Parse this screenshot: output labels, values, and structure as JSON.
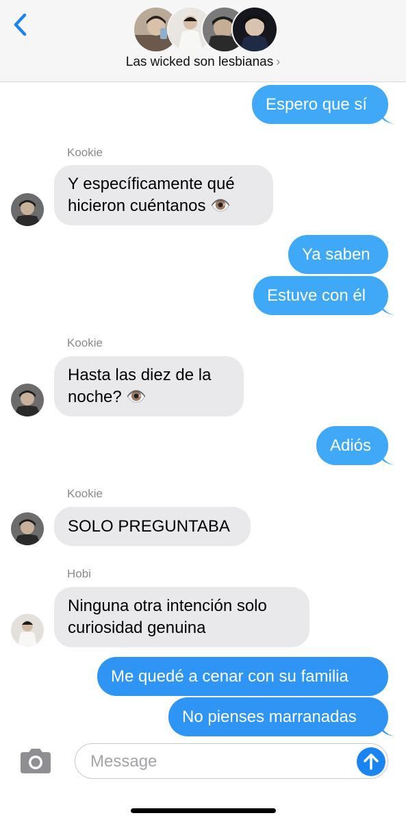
{
  "header": {
    "title": "Las wicked son lesbianas",
    "chevron": "›",
    "back_icon": "chevron-left-icon"
  },
  "messages": [
    {
      "direction": "out",
      "text": "Espero que sí"
    },
    {
      "direction": "in",
      "sender": "Kookie",
      "line1": "Y específicamente qué",
      "line2": "hicieron cuéntanos 👁️"
    },
    {
      "direction": "out",
      "text": "Ya saben"
    },
    {
      "direction": "out",
      "text": "Estuve con él"
    },
    {
      "direction": "in",
      "sender": "Kookie",
      "line1": "Hasta las diez de la",
      "line2": "noche? 👁️"
    },
    {
      "direction": "out",
      "text": "Adiós"
    },
    {
      "direction": "in",
      "sender": "Kookie",
      "text": "SOLO PREGUNTABA"
    },
    {
      "direction": "in",
      "sender": "Hobi",
      "line1": "Ninguna otra intención solo",
      "line2": "curiosidad genuina"
    },
    {
      "direction": "out",
      "text": "Me quedé a cenar con su familia"
    },
    {
      "direction": "out",
      "text": "No pienses marranadas"
    }
  ],
  "composer": {
    "placeholder": "Message",
    "camera_icon": "camera-icon",
    "send_icon": "send-arrow-up-icon"
  },
  "colors": {
    "outgoing_bubble": "#2f95f5",
    "incoming_bubble": "#e9e9eb",
    "accent": "#1a84f0"
  }
}
